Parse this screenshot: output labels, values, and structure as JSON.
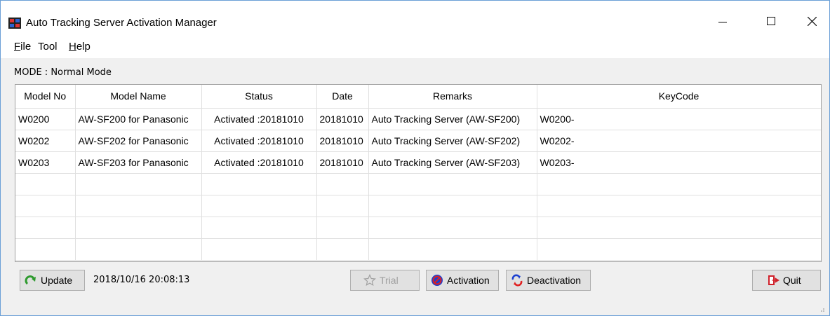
{
  "window": {
    "title": "Auto Tracking Server Activation Manager"
  },
  "menu": [
    {
      "label": "File",
      "accel": "F",
      "rest": "ile"
    },
    {
      "label": "Tool",
      "accel": "",
      "rest": "Tool"
    },
    {
      "label": "Help",
      "accel": "H",
      "rest": "elp"
    }
  ],
  "mode_text": "MODE : Normal Mode",
  "table": {
    "columns": [
      "Model No",
      "Model Name",
      "Status",
      "Date",
      "Remarks",
      "KeyCode"
    ],
    "rows": [
      [
        "W0200",
        "AW-SF200 for Panasonic",
        "Activated :20181010",
        "20181010",
        "Auto Tracking Server (AW-SF200)",
        "W0200-"
      ],
      [
        "W0202",
        "AW-SF202 for Panasonic",
        "Activated :20181010",
        "20181010",
        "Auto Tracking Server (AW-SF202)",
        "W0202-"
      ],
      [
        "W0203",
        "AW-SF203 for Panasonic",
        "Activated :20181010",
        "20181010",
        "Auto Tracking Server (AW-SF203)",
        "W0203-"
      ],
      [
        "",
        "",
        "",
        "",
        "",
        ""
      ],
      [
        "",
        "",
        "",
        "",
        "",
        ""
      ],
      [
        "",
        "",
        "",
        "",
        "",
        ""
      ],
      [
        "",
        "",
        "",
        "",
        "",
        ""
      ]
    ]
  },
  "buttons": {
    "update": "Update",
    "trial": "Trial",
    "activation": "Activation",
    "deactivation": "Deactivation",
    "quit": "Quit"
  },
  "timestamp": "2018/10/16 20:08:13",
  "colors": {
    "window_border": "#6a9fd6",
    "button_face": "#e1e1e1",
    "update_icon": "#2e9a2e",
    "activation_icon": "#1b3fd0",
    "quit_icon": "#d0202a"
  }
}
